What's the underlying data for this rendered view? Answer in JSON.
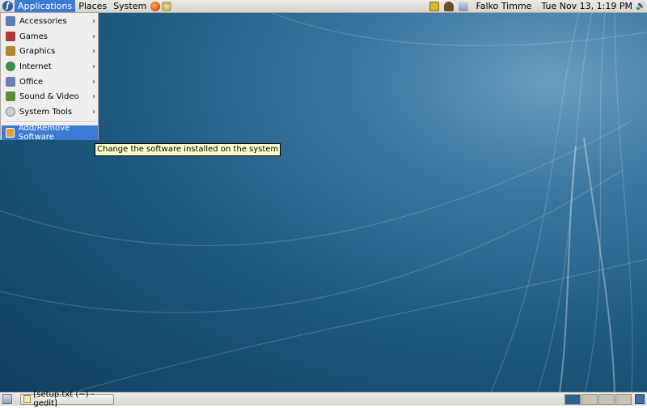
{
  "top_panel": {
    "menus": [
      {
        "label": "Applications"
      },
      {
        "label": "Places"
      },
      {
        "label": "System"
      }
    ],
    "launchers": [
      "firefox-icon",
      "mail-icon"
    ],
    "tray_icons": [
      "notes-icon",
      "package-updater-icon",
      "network-icon"
    ],
    "user": "Falko Timme",
    "clock": "Tue Nov 13,  1:19 PM",
    "volume_icon": "volume-icon"
  },
  "applications_menu": {
    "items": [
      {
        "label": "Accessories",
        "icon": "accessories-icon",
        "color": "#5a7fb0"
      },
      {
        "label": "Games",
        "icon": "games-icon",
        "color": "#b23a3a"
      },
      {
        "label": "Graphics",
        "icon": "graphics-icon",
        "color": "#b8862a"
      },
      {
        "label": "Internet",
        "icon": "internet-icon",
        "color": "#3d8a4f"
      },
      {
        "label": "Office",
        "icon": "office-icon",
        "color": "#6d7fb5"
      },
      {
        "label": "Sound & Video",
        "icon": "sound-video-icon",
        "color": "#5b8a3a"
      },
      {
        "label": "System Tools",
        "icon": "system-tools-icon",
        "color": "#9a9a9a"
      }
    ],
    "special": {
      "label": "Add/Remove Software",
      "icon": "add-remove-software-icon"
    },
    "submenu_arrow": "›"
  },
  "tooltip": "Change the software installed on the system",
  "taskbar": {
    "show_desktop_icon": "show-desktop-icon",
    "window_button": "[setup.txt (~) - gedit]",
    "workspaces": 4,
    "active_workspace": 1,
    "trash_icon": "trash-icon"
  },
  "colors": {
    "accent": "#3c7ad3",
    "tooltip_bg": "#fcfcc8"
  }
}
